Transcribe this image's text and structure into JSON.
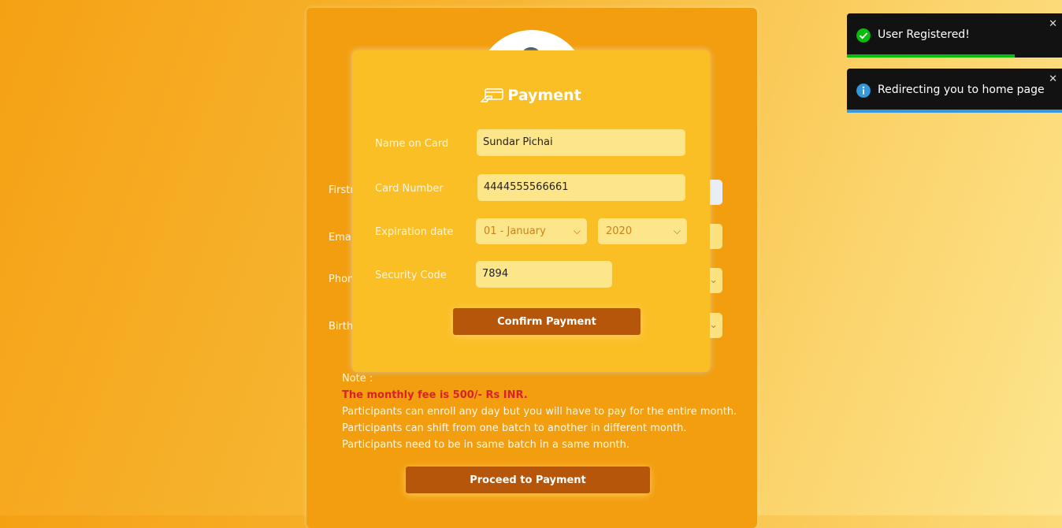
{
  "form": {
    "labels": {
      "firstname": "Firstn",
      "email": "Email",
      "phone": "Phon",
      "birth": "Birth"
    },
    "note": {
      "heading": "Note :",
      "fee": "The monthly fee is 500/- Rs INR.",
      "lines": [
        "Participants can enroll any day but you will have to pay for the entire month.",
        "Participants can shift from one batch to another in different month.",
        "Participants need to be in same batch in a same month."
      ]
    },
    "proceed_label": "Proceed to Payment"
  },
  "payment": {
    "title": "Payment",
    "icon": "card-payment-icon",
    "name_label": "Name on Card",
    "name_value": "Sundar Pichai",
    "card_label": "Card Number",
    "card_value": "4444555566661",
    "expiry_label": "Expiration date",
    "month_value": "01 - January",
    "year_value": "2020",
    "security_label": "Security Code",
    "security_value": "7894",
    "confirm_label": "Confirm Payment"
  },
  "toasts": [
    {
      "message": "User Registered!",
      "icon": "check-circle-icon",
      "color": "#07bc0c",
      "progress": 0.78
    },
    {
      "message": "Redirecting you to home page",
      "icon": "info-circle-icon",
      "color": "#3498db",
      "progress": 1.0
    }
  ],
  "colors": {
    "brand_brown": "#b5560b",
    "fee_red": "#d7222a",
    "modal_yellow": "#fbbf26"
  }
}
